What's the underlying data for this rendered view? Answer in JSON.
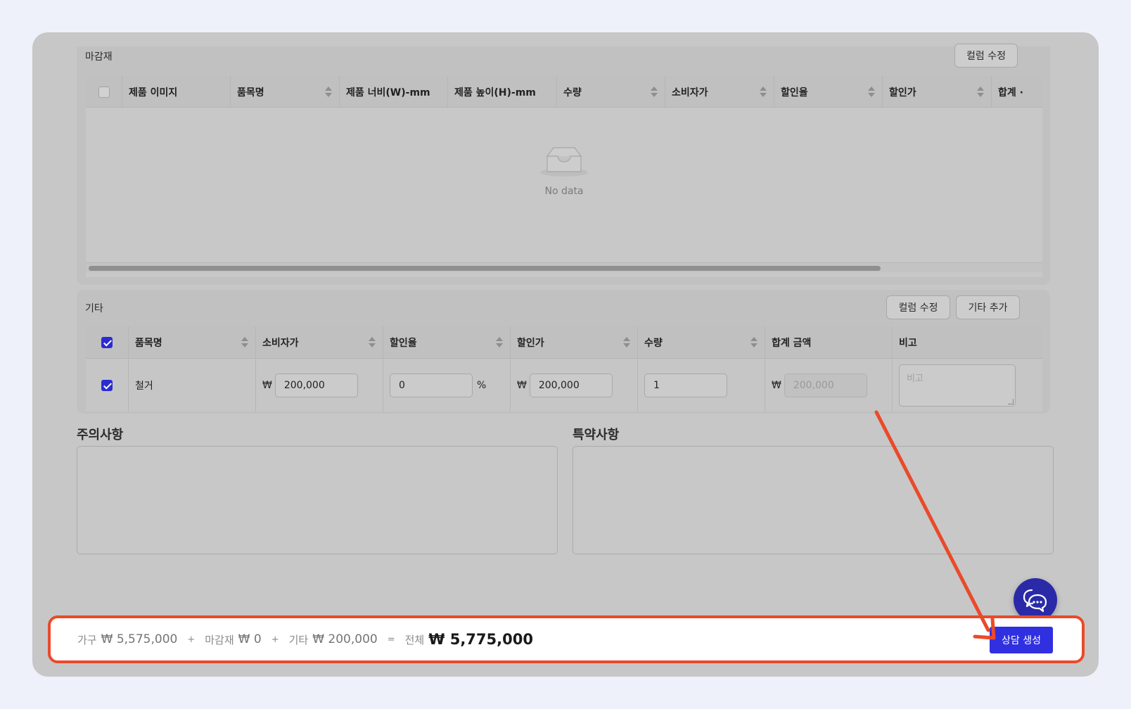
{
  "finishing": {
    "title": "마감재",
    "edit_columns_label": "컬럼 수정",
    "columns": [
      "제품 이미지",
      "품목명",
      "제품 너비(W)-mm",
      "제품 높이(H)-mm",
      "수량",
      "소비자가",
      "할인율",
      "할인가",
      "합계 ·"
    ],
    "empty_text": "No data"
  },
  "other": {
    "title": "기타",
    "edit_columns_label": "컬럼 수정",
    "add_label": "기타 추가",
    "columns": [
      "품목명",
      "소비자가",
      "할인율",
      "할인가",
      "수량",
      "합계 금액",
      "비고"
    ],
    "rows": [
      {
        "checked": true,
        "name": "철거",
        "currency": "₩",
        "consumer_price": "200,000",
        "discount_rate": "0",
        "percent": "%",
        "discount_price": "200,000",
        "quantity": "1",
        "total": "200,000",
        "note_placeholder": "비고"
      }
    ]
  },
  "notes": {
    "caution_label": "주의사항",
    "special_label": "특약사항"
  },
  "summary": {
    "furniture_label": "가구",
    "furniture_value": "₩ 5,575,000",
    "plus": "+",
    "finishing_label": "마감재",
    "finishing_value": "₩ 0",
    "other_label": "기타",
    "other_value": "₩ 200,000",
    "equals": "=",
    "total_label": "전체",
    "total_value": "₩ 5,775,000",
    "create_button": "상담 생성"
  },
  "colors": {
    "accent": "#3030e0",
    "highlight": "#ea4a2a",
    "overlay": "#c7c7c7"
  }
}
